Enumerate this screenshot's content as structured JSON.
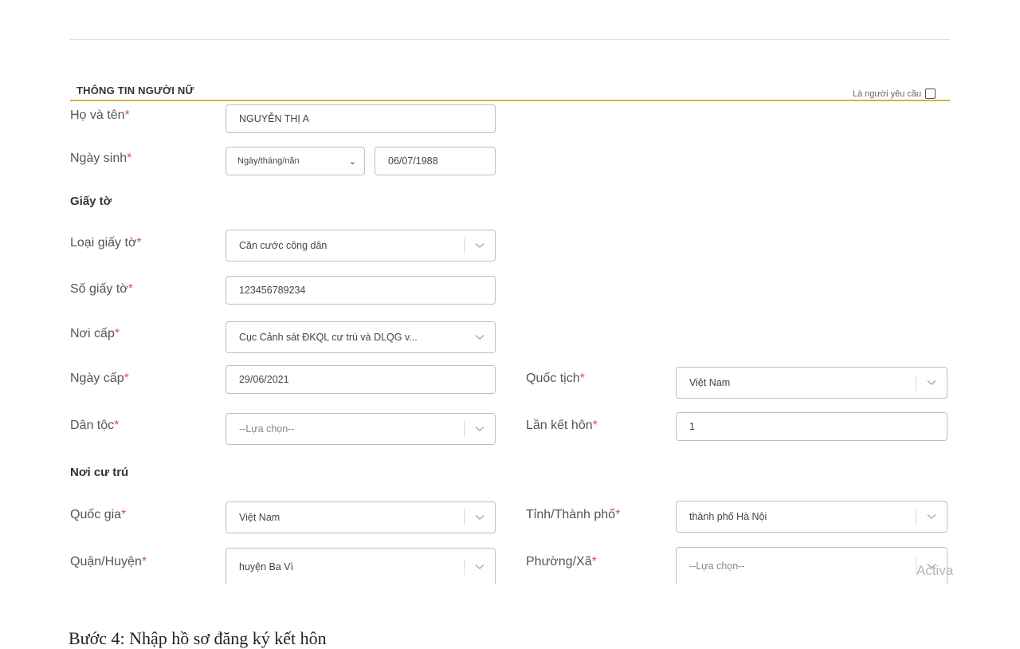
{
  "section": {
    "title": "THÔNG TIN NGƯỜI NỮ",
    "requester_label": "Là người yêu cầu",
    "requester_checked": false
  },
  "fields": {
    "full_name": {
      "label": "Họ và tên",
      "value": "NGUYỄN THỊ A"
    },
    "birth_date": {
      "label": "Ngày sinh",
      "format": "Ngày/tháng/năn",
      "value": "06/07/1988"
    },
    "id_type": {
      "label": "Loại giấy tờ",
      "value": "Căn cước công dân"
    },
    "id_number": {
      "label": "Số giấy tờ",
      "value": "123456789234"
    },
    "issued_by": {
      "label": "Nơi cấp",
      "value": "Cục Cảnh sát ĐKQL cư trú và DLQG v..."
    },
    "issue_date": {
      "label": "Ngày cấp",
      "value": "29/06/2021"
    },
    "nationality": {
      "label": "Quốc tịch",
      "value": "Việt Nam"
    },
    "ethnicity": {
      "label": "Dân tộc",
      "value": "--Lựa chọn--"
    },
    "marriage_count": {
      "label": "Lần kết hôn",
      "value": "1"
    },
    "country": {
      "label": "Quốc gia",
      "value": "Việt Nam"
    },
    "province": {
      "label": "Tỉnh/Thành phố",
      "value": "thành phố Hà Nội"
    },
    "district": {
      "label": "Quận/Huyện",
      "value": "huyện Ba Vì"
    },
    "ward": {
      "label": "Phường/Xã",
      "value": "--Lựa chọn--"
    }
  },
  "groups": {
    "documents": "Giấy tờ",
    "residence": "Nơi cư trú"
  },
  "required_mark": "*",
  "watermark": "Activa",
  "caption": "Bước 4: Nhập hồ sơ đăng ký kết hôn",
  "colors": {
    "accent": "#d8b04a",
    "required": "#d9534f"
  },
  "icons": {
    "chevron": "chevron-down-icon",
    "caret": "caret-down-icon"
  }
}
